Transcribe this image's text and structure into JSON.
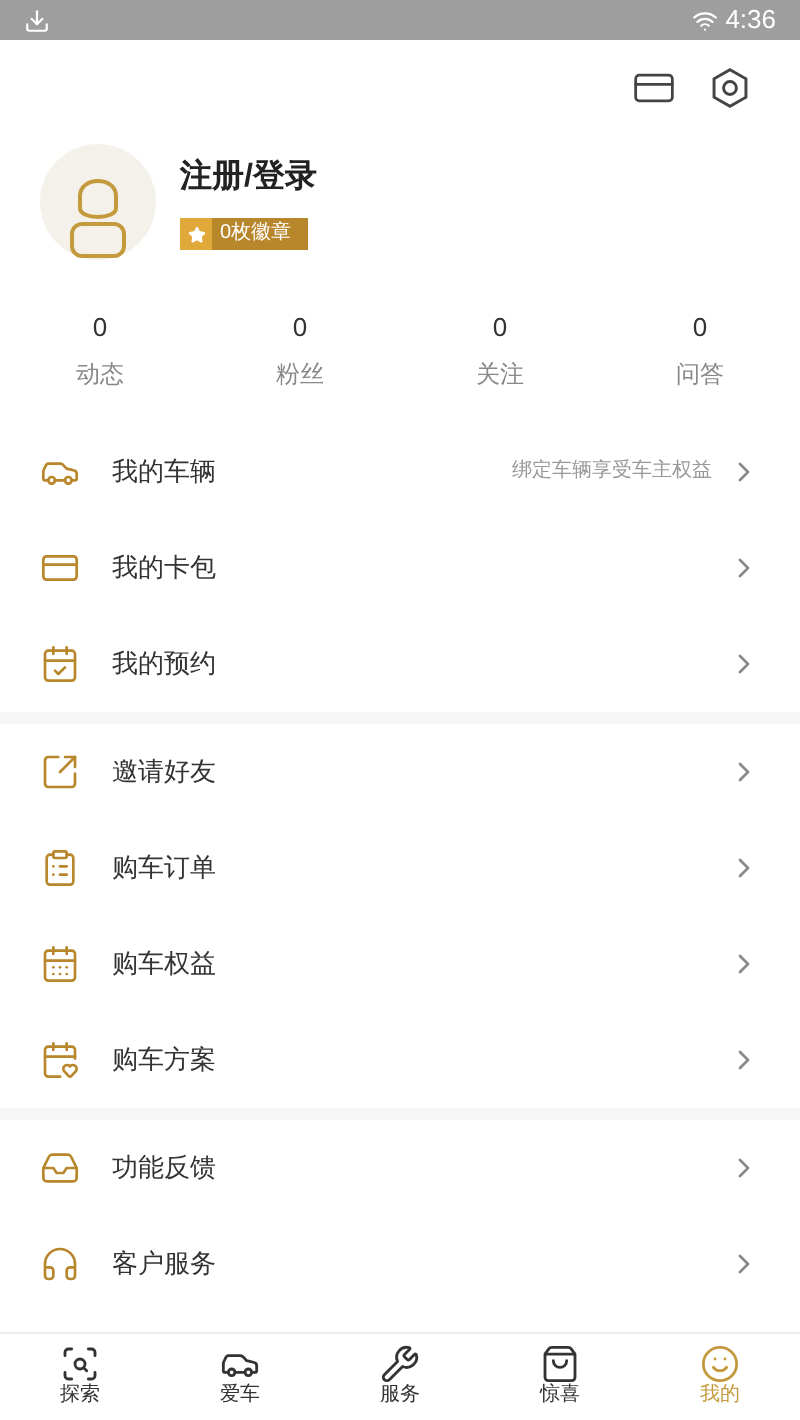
{
  "status_bar": {
    "time": "4:36"
  },
  "profile": {
    "name": "注册/登录",
    "badge": "0枚徽章"
  },
  "stats": [
    {
      "value": "0",
      "label": "动态"
    },
    {
      "value": "0",
      "label": "粉丝"
    },
    {
      "value": "0",
      "label": "关注"
    },
    {
      "value": "0",
      "label": "问答"
    }
  ],
  "menu_sections": [
    [
      {
        "label": "我的车辆",
        "hint": "绑定车辆享受车主权益"
      },
      {
        "label": "我的卡包"
      },
      {
        "label": "我的预约"
      }
    ],
    [
      {
        "label": "邀请好友"
      },
      {
        "label": "购车订单"
      },
      {
        "label": "购车权益"
      },
      {
        "label": "购车方案"
      }
    ],
    [
      {
        "label": "功能反馈"
      },
      {
        "label": "客户服务"
      }
    ]
  ],
  "bottom_nav": [
    {
      "label": "探索",
      "selected": false
    },
    {
      "label": "爱车",
      "selected": false
    },
    {
      "label": "服务",
      "selected": false
    },
    {
      "label": "惊喜",
      "selected": false
    },
    {
      "label": "我的",
      "selected": true
    }
  ]
}
